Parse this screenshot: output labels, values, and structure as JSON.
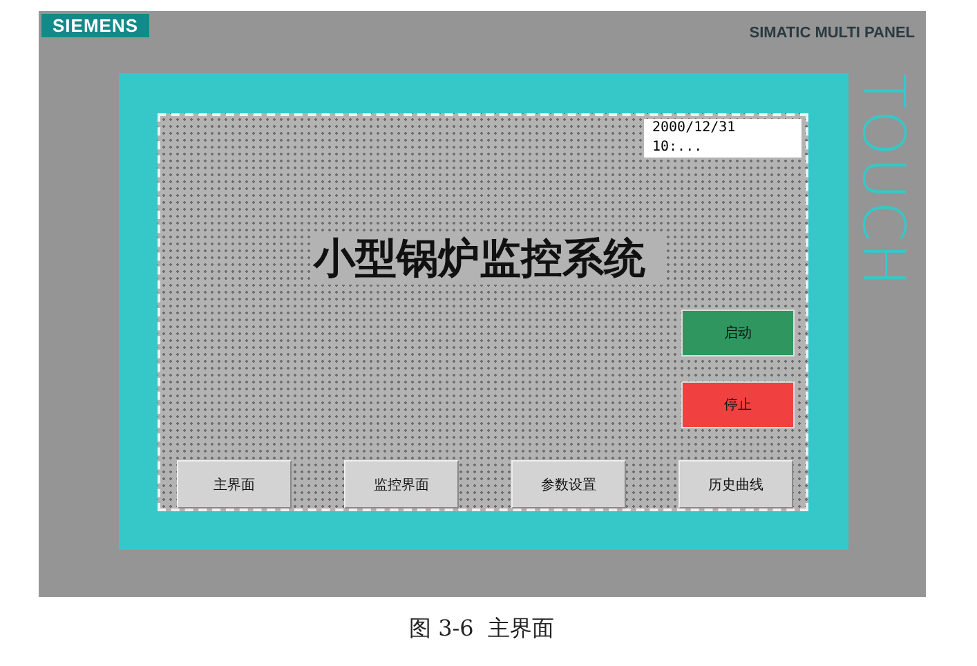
{
  "device": {
    "brand": "SIEMENS",
    "model": "SIMATIC MULTI PANEL",
    "side_label": "TOUCH"
  },
  "screen": {
    "datetime": "2000/12/31 10:...",
    "title": "小型锅炉监控系统",
    "control_buttons": [
      {
        "label": "启动",
        "kind": "start"
      },
      {
        "label": "停止",
        "kind": "stop"
      }
    ],
    "nav_buttons": [
      {
        "label": "主界面"
      },
      {
        "label": "监控界面"
      },
      {
        "label": "参数设置"
      },
      {
        "label": "历史曲线"
      }
    ]
  },
  "caption": "图 3-6  主界面"
}
